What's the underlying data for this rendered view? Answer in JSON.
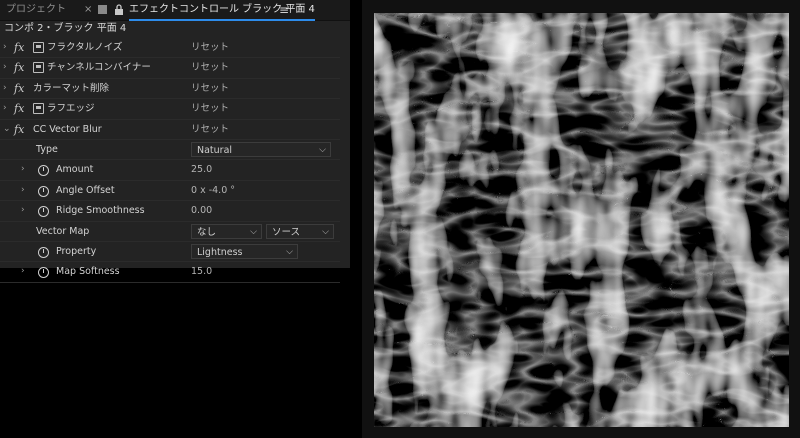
{
  "tabs": {
    "project": "プロジェクト",
    "close": "×",
    "effect_controls": "エフェクトコントロール ブラック 平面 4",
    "menu": "≡"
  },
  "breadcrumb": "コンポ 2・ブラック 平面 4",
  "effects": [
    {
      "name": "フラクタルノイズ",
      "reset": "リセット"
    },
    {
      "name": "チャンネルコンバイナー",
      "reset": "リセット"
    },
    {
      "name": "カラーマット削除",
      "reset": "リセット"
    },
    {
      "name": "ラフエッジ",
      "reset": "リセット"
    },
    {
      "name": "CC Vector Blur",
      "reset": "リセット"
    }
  ],
  "vector_blur": {
    "type_label": "Type",
    "type_value": "Natural",
    "amount_label": "Amount",
    "amount_value": "25.0",
    "angle_label": "Angle Offset",
    "angle_value": "0 x -4.0 °",
    "ridge_label": "Ridge Smoothness",
    "ridge_value": "0.00",
    "vector_map_label": "Vector Map",
    "vector_map_layer": "なし",
    "vector_map_source": "ソース",
    "property_label": "Property",
    "property_value": "Lightness",
    "softness_label": "Map Softness",
    "softness_value": "15.0"
  },
  "colors": {
    "panel_bg": "#232323",
    "accent": "#2d8ceb"
  }
}
